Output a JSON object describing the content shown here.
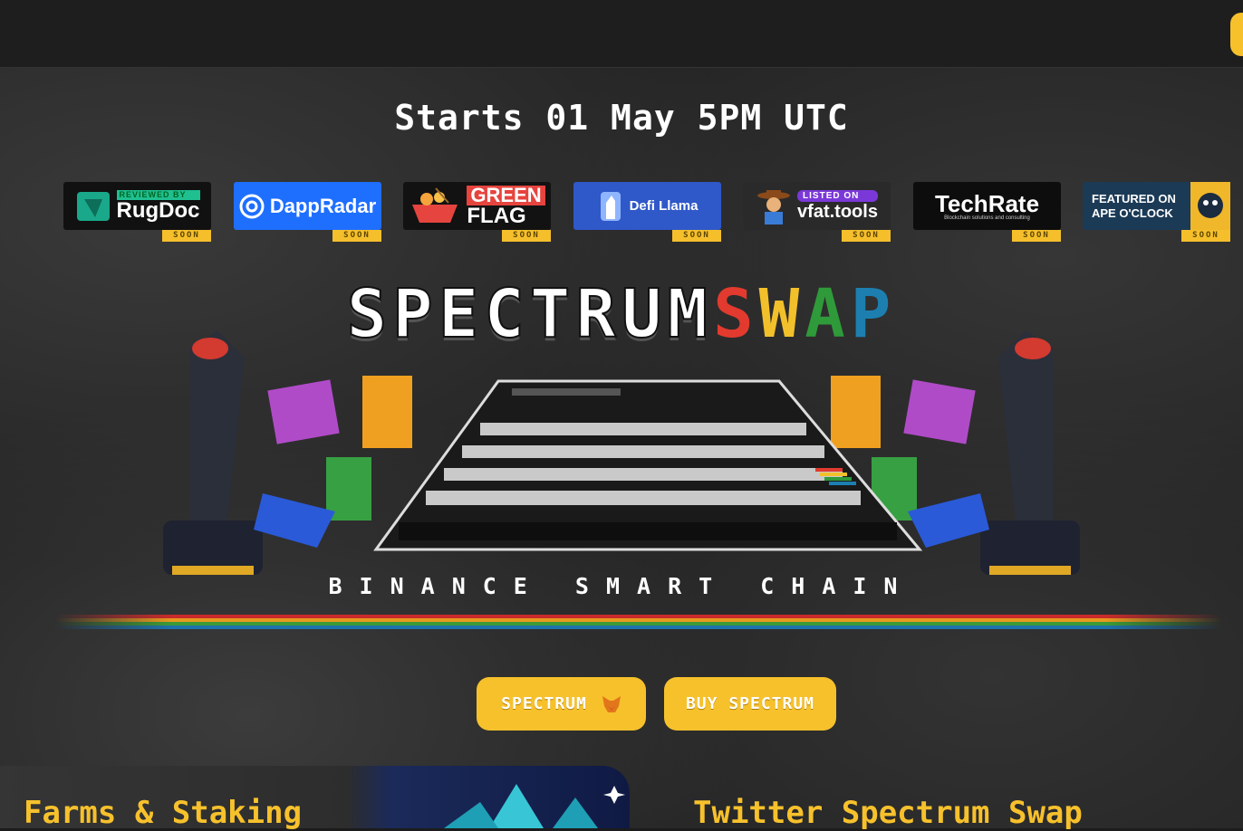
{
  "countdown": "Starts 01 May 5PM UTC",
  "partners": [
    {
      "name": "RugDoc",
      "tag": "REVIEWED BY",
      "badge": "SOON"
    },
    {
      "name": "DappRadar",
      "badge": "SOON"
    },
    {
      "name": "GREEN",
      "name2": "FLAG",
      "badge": "SOON"
    },
    {
      "name": "Defi Llama",
      "badge": "SOON"
    },
    {
      "name": "vfat.tools",
      "tag": "LISTED ON",
      "badge": "SOON"
    },
    {
      "name": "TechRate",
      "tag": "Blockchain solutions and consulting",
      "badge": "SOON"
    },
    {
      "name": "FEATURED ON",
      "name2": "APE O'CLOCK",
      "badge": "SOON"
    }
  ],
  "hero": {
    "title_a": "SPECTRUM",
    "title_s": "S",
    "title_w": "W",
    "title_a2": "A",
    "title_p": "P",
    "subtitle": "BINANCE SMART CHAIN"
  },
  "buttons": {
    "add_token": "SPECTRUM",
    "buy": "BUY SPECTRUM"
  },
  "sections": {
    "farms": "Farms & Staking",
    "twitter": "Twitter Spectrum Swap"
  },
  "colors": {
    "accent": "#f7c12c",
    "background": "#242424",
    "spectrum_red": "#e23a2e",
    "spectrum_yellow": "#f2c02a",
    "spectrum_green": "#2f9a3a",
    "spectrum_blue": "#1c7fb0"
  },
  "icons": {
    "add_token": "metamask-fox-icon"
  }
}
